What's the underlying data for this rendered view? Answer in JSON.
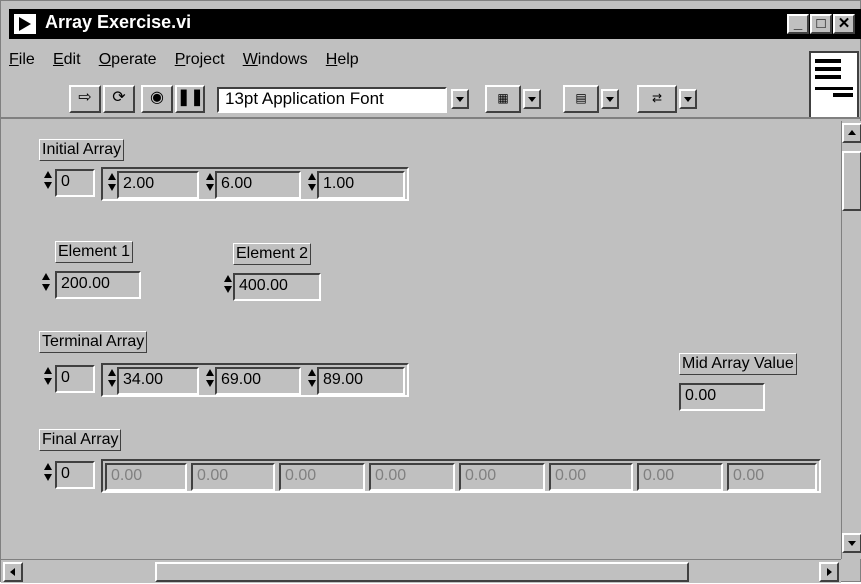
{
  "window": {
    "title": "Array Exercise.vi"
  },
  "menu": [
    "File",
    "Edit",
    "Operate",
    "Project",
    "Windows",
    "Help"
  ],
  "toolbar": {
    "font": "13pt Application Font"
  },
  "initial_array": {
    "label": "Initial Array",
    "index": "0",
    "values": [
      "2.00",
      "6.00",
      "1.00"
    ]
  },
  "element1": {
    "label": "Element 1",
    "value": "200.00"
  },
  "element2": {
    "label": "Element 2",
    "value": "400.00"
  },
  "terminal_array": {
    "label": "Terminal Array",
    "index": "0",
    "values": [
      "34.00",
      "69.00",
      "89.00"
    ]
  },
  "mid_array_value": {
    "label": "Mid Array Value",
    "value": "0.00"
  },
  "final_array": {
    "label": "Final Array",
    "index": "0",
    "values": [
      "0.00",
      "0.00",
      "0.00",
      "0.00",
      "0.00",
      "0.00",
      "0.00",
      "0.00"
    ]
  }
}
